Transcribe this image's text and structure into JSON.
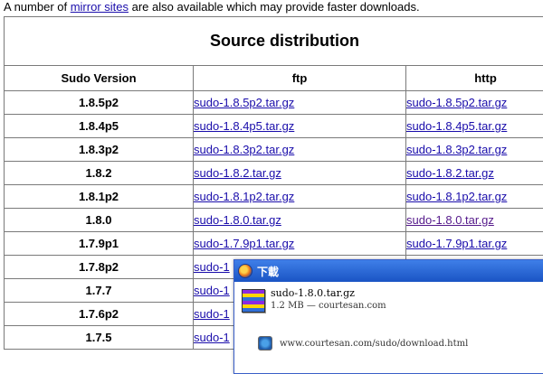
{
  "intro": {
    "before": "A number of ",
    "link": "mirror sites",
    "after": " are also available which may provide faster downloads."
  },
  "table": {
    "title": "Source distribution",
    "headers": [
      "Sudo Version",
      "ftp",
      "http"
    ],
    "rows": [
      {
        "version": "1.8.5p2",
        "ftp": "sudo-1.8.5p2.tar.gz",
        "http": "sudo-1.8.5p2.tar.gz"
      },
      {
        "version": "1.8.4p5",
        "ftp": "sudo-1.8.4p5.tar.gz",
        "http": "sudo-1.8.4p5.tar.gz"
      },
      {
        "version": "1.8.3p2",
        "ftp": "sudo-1.8.3p2.tar.gz",
        "http": "sudo-1.8.3p2.tar.gz"
      },
      {
        "version": "1.8.2",
        "ftp": "sudo-1.8.2.tar.gz",
        "http": "sudo-1.8.2.tar.gz"
      },
      {
        "version": "1.8.1p2",
        "ftp": "sudo-1.8.1p2.tar.gz",
        "http": "sudo-1.8.1p2.tar.gz"
      },
      {
        "version": "1.8.0",
        "ftp": "sudo-1.8.0.tar.gz",
        "http": "sudo-1.8.0.tar.gz"
      },
      {
        "version": "1.7.9p1",
        "ftp": "sudo-1.7.9p1.tar.gz",
        "http": "sudo-1.7.9p1.tar.gz"
      },
      {
        "version": "1.7.8p2",
        "ftp": "sudo-1",
        "http": ""
      },
      {
        "version": "1.7.7",
        "ftp": "sudo-1",
        "http": ""
      },
      {
        "version": "1.7.6p2",
        "ftp": "sudo-1",
        "http": ""
      },
      {
        "version": "1.7.5",
        "ftp": "sudo-1",
        "http": ""
      }
    ]
  },
  "popup": {
    "title": "下載",
    "filename": "sudo-1.8.0.tar.gz",
    "info": "1.2 MB — courtesan.com",
    "source_url": "www.courtesan.com/sudo/download.html"
  },
  "colors": {
    "link": "#1a0dab",
    "visited_link": "#551a8b",
    "titlebar": "#1a54c4"
  },
  "icons": {
    "popup_app": "firefox-icon",
    "file": "rar-archive-icon",
    "source": "globe-icon"
  }
}
